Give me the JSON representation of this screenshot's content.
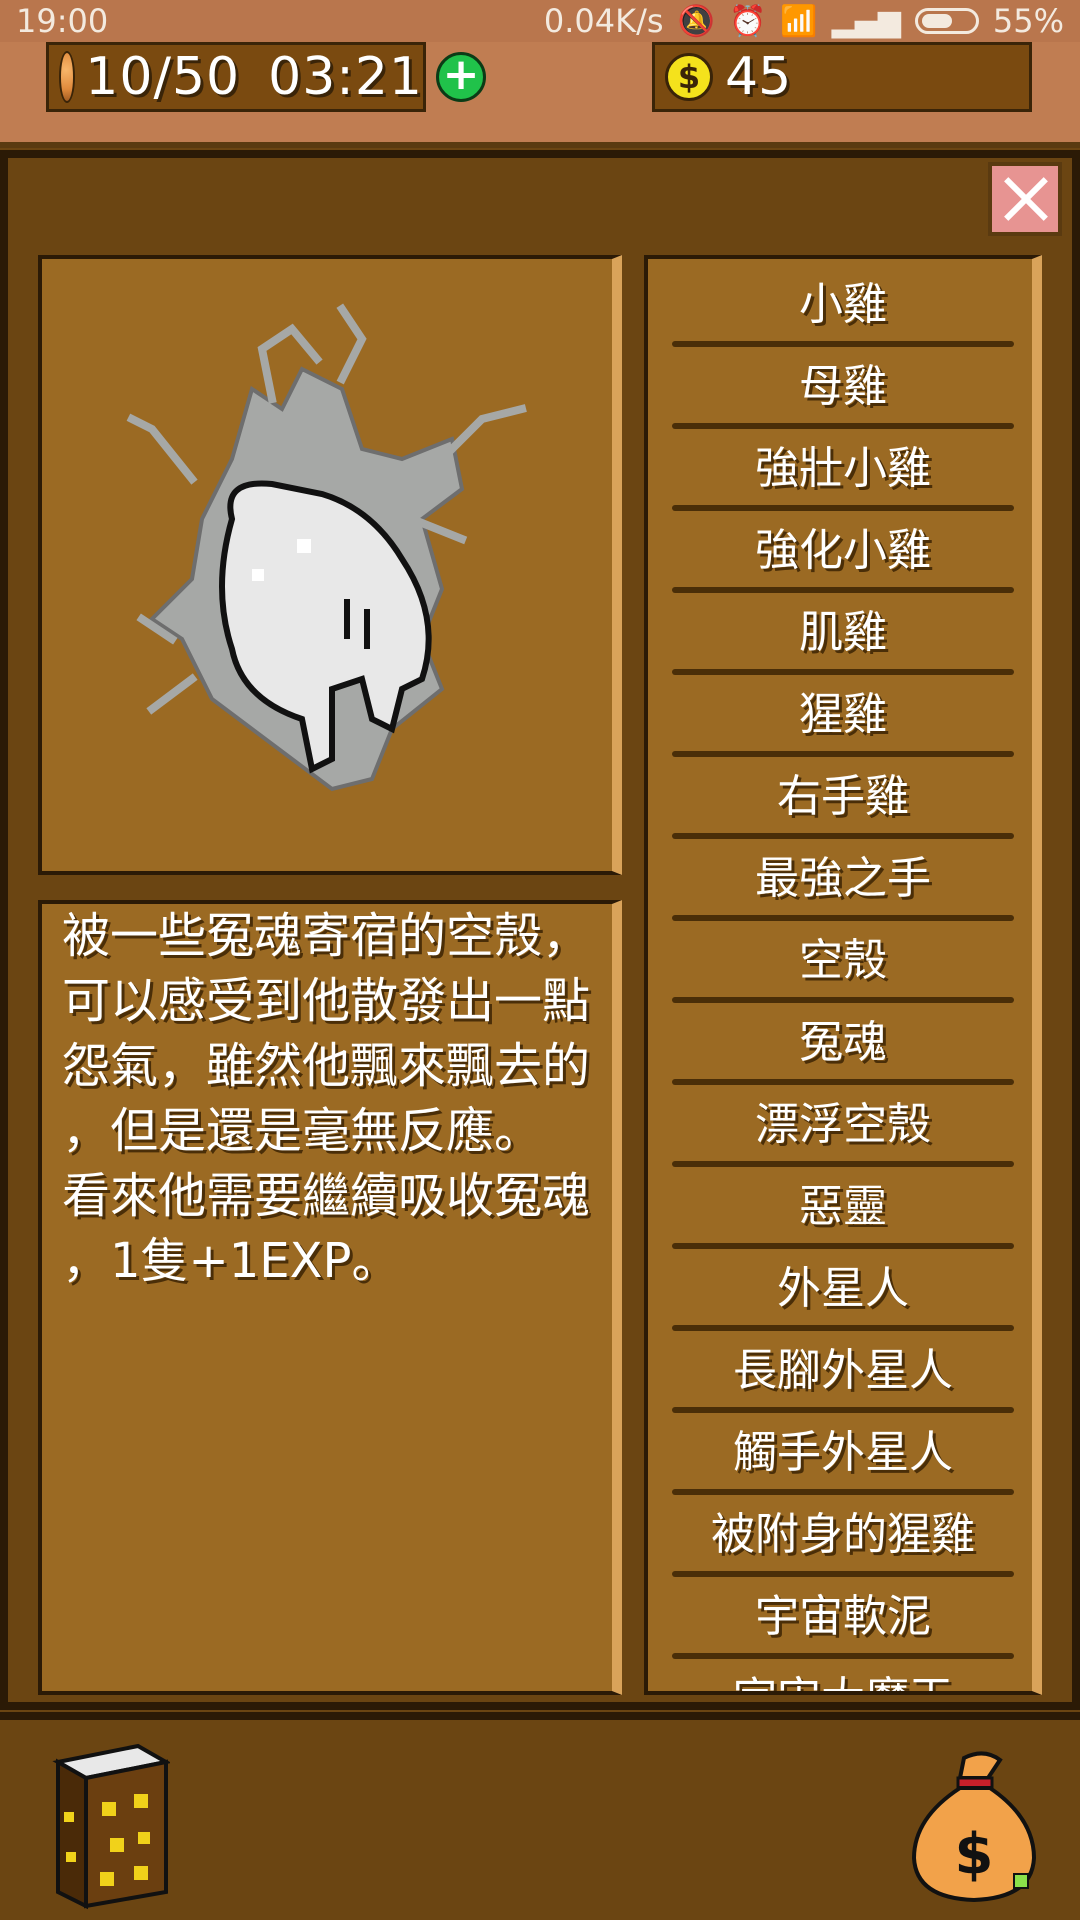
{
  "status_bar": {
    "time": "19:00",
    "network_speed": "0.04K/s",
    "battery": "55%",
    "icons": [
      "mute-icon",
      "alarm-icon",
      "wifi-icon",
      "signal-icon",
      "battery-icon"
    ]
  },
  "resources": {
    "energy": "10/50",
    "energy_timer": "03:21",
    "coins": "45",
    "coin_symbol": "$",
    "add_symbol": "+"
  },
  "detail": {
    "description": "被一些冤魂寄宿的空殼，\n可以感受到他散發出一點\n怨氣，雖然他飄來飄去的\n，但是還是毫無反應。\n看來他需要繼續吸收冤魂\n，1隻+1EXP。"
  },
  "creature_list": {
    "items": [
      "小雞",
      "母雞",
      "強壯小雞",
      "強化小雞",
      "肌雞",
      "猩雞",
      "右手雞",
      "最強之手",
      "空殼",
      "冤魂",
      "漂浮空殼",
      "惡靈",
      "外星人",
      "長腳外星人",
      "觸手外星人",
      "被附身的猩雞",
      "宇宙軟泥",
      "宇宙大魔王"
    ]
  },
  "colors": {
    "panel_bg": "#9b6a23",
    "frame_dark": "#2b1a06",
    "status_bar": "#b9764d",
    "add_button": "#20c24a",
    "close_button": "#e79492",
    "coin": "#f4e21c"
  }
}
